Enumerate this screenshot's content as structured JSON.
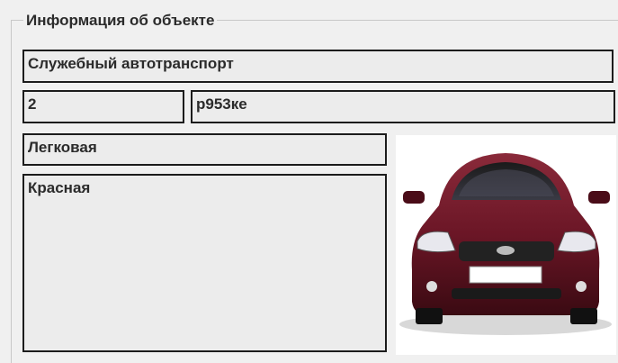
{
  "group": {
    "title": "Информация об объекте"
  },
  "fields": {
    "name": "Служебный автотранспорт",
    "number": "2",
    "plate": "р953ке",
    "type": "Легковая",
    "color": "Красная"
  },
  "photo": {
    "subject": "car-photo",
    "body_color": "#7a1e2e"
  }
}
